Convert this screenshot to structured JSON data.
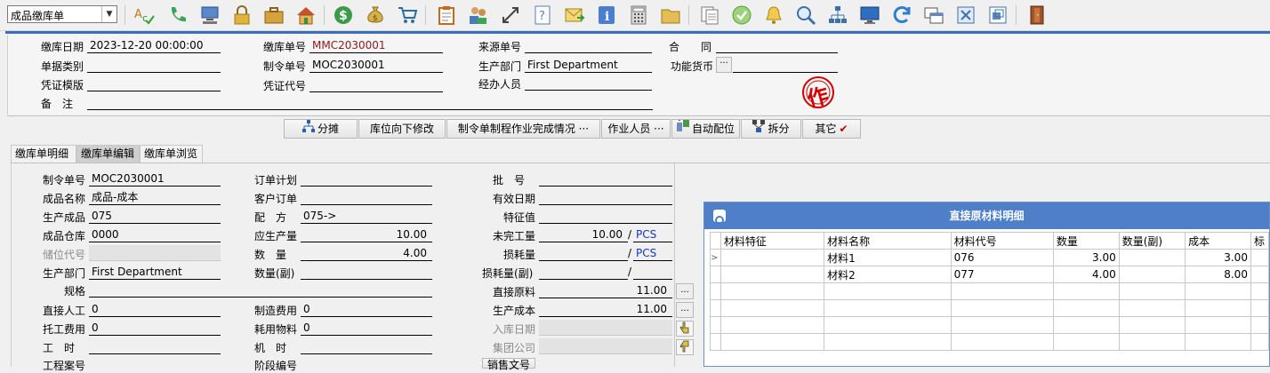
{
  "toolbar": {
    "doc_type_selected": "成品缴库单",
    "icons": [
      "spell-check-icon",
      "phone-icon",
      "computer-icon",
      "lock-icon",
      "briefcase-icon",
      "home-icon",
      "dollar-coin-icon",
      "money-bag-icon",
      "cart-icon",
      "clipboard-icon",
      "users-icon",
      "arrows-icon",
      "help-doc-icon",
      "mail-icon",
      "info-icon",
      "calculator-icon",
      "folder-icon",
      "copy-doc-icon",
      "check-circle-icon",
      "bell-icon",
      "magnifier-icon",
      "org-chart-icon",
      "monitor-icon",
      "refresh-icon",
      "windows-icon",
      "close-box-icon",
      "restore-icon",
      "exit-door-icon"
    ]
  },
  "header": {
    "date_label": "缴库日期",
    "date_value": "2023-12-20 00:00:00",
    "category_label": "单据类别",
    "category_value": "",
    "voucher_template_label": "凭证模版",
    "voucher_template_value": "",
    "remark_label": "备　注",
    "remark_value": "",
    "doc_no_label": "缴库单号",
    "doc_no_value": "MMC2030001",
    "mo_no_label": "制令单号",
    "mo_no_value": "MOC2030001",
    "voucher_code_label": "凭证代号",
    "voucher_code_value": "",
    "source_no_label": "来源单号",
    "source_no_value": "",
    "dept_label": "生产部门",
    "dept_value": "First Department",
    "handler_label": "经办人员",
    "handler_value": "",
    "contract_label": "合　　同",
    "contract_value": "",
    "currency_label": "功能货币",
    "currency_button": "···",
    "currency_value": "",
    "stamp_char": "作"
  },
  "actions": {
    "allocate": "分摊",
    "location_down": "库位向下修改",
    "process_done": "制令单制程作业完成情况 ···",
    "operator": "作业人员 ···",
    "auto_match": "自动配位",
    "split": "拆分",
    "other": "其它"
  },
  "tabs": [
    "缴库单明细",
    "缴库单编辑",
    "缴库单浏览"
  ],
  "form": {
    "mo_no_label": "制令单号",
    "mo_no_value": "MOC2030001",
    "product_name_label": "成品名称",
    "product_name_value": "成品-成本",
    "product_label": "生产成品",
    "product_value": "075",
    "warehouse_label": "成品仓库",
    "warehouse_value": "0000",
    "storage_label": "储位代号",
    "storage_value": "",
    "dept_label": "生产部门",
    "dept_value": "First Department",
    "spec_label": "规格",
    "spec_value": "",
    "direct_labor_label": "直接人工",
    "direct_labor_value": "0",
    "outsource_label": "托工费用",
    "outsource_value": "0",
    "hours_label": "工　时",
    "hours_value": "",
    "project_label": "工程案号",
    "order_plan_label": "订单计划",
    "order_plan_value": "",
    "customer_order_label": "客户订单",
    "customer_order_value": "",
    "formula_label": "配　方",
    "formula_value": "075->",
    "plan_qty_label": "应生产量",
    "plan_qty_value": "10.00",
    "qty_label": "数　量",
    "qty_value": "4.00",
    "qty2_label": "数量(副)",
    "qty2_value": "",
    "mfg_cost_label": "制造费用",
    "mfg_cost_value": "0",
    "consumables_label": "耗用物料",
    "consumables_value": "0",
    "machine_hours_label": "机　时",
    "machine_hours_value": "",
    "stage_label": "阶段编号",
    "batch_label": "批　号",
    "batch_value": "",
    "expiry_label": "有效日期",
    "expiry_value": "",
    "feature_label": "特征值",
    "feature_value": "",
    "unfinished_label": "未完工量",
    "unfinished_value": "10.00",
    "unfinished_unit": "PCS",
    "loss_label": "损耗量",
    "loss_value": "",
    "loss_unit": "PCS",
    "loss2_label": "损耗量(副)",
    "loss2_value": "",
    "direct_material_label": "直接原料",
    "direct_material_value": "11.00",
    "production_cost_label": "生产成本",
    "production_cost_value": "11.00",
    "in_date_label": "入库日期",
    "in_date_value": "",
    "group_company_label": "集团公司",
    "group_company_value": "",
    "sales_doc_button": "销售文号",
    "ellipsis": "..."
  },
  "material_panel": {
    "title": "直接原材料明细",
    "columns": [
      "材料特征",
      "材料名称",
      "材料代号",
      "数量",
      "数量(副)",
      "成本",
      "标"
    ],
    "rows": [
      {
        "feature": "",
        "name": "材料1",
        "code": "076",
        "qty": "3.00",
        "qty2": "",
        "cost": "3.00"
      },
      {
        "feature": "",
        "name": "材料2",
        "code": "077",
        "qty": "4.00",
        "qty2": "",
        "cost": "8.00"
      }
    ]
  },
  "colors": {
    "accent_blue": "#3a6fb7",
    "panel_title_bg": "#4f7fc8",
    "doc_no_red": "#8b1a1a",
    "unit_blue": "#1a35b8",
    "stamp_red": "#d40000"
  }
}
